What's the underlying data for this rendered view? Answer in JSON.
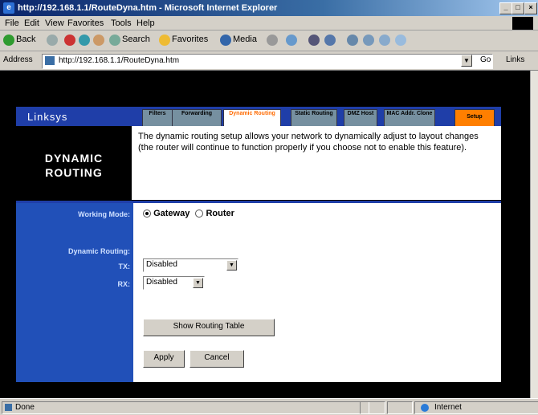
{
  "window": {
    "title": "http://192.168.1.1/RouteDyna.htm - Microsoft Internet Explorer",
    "min_btn": "_",
    "max_btn": "□",
    "close_btn": "×"
  },
  "menu": [
    "File",
    "Edit",
    "View",
    "Favorites",
    "Tools",
    "Help"
  ],
  "toolbar": {
    "back": "Back",
    "search": "Search",
    "favorites": "Favorites",
    "media": "Media"
  },
  "address": {
    "label": "Address",
    "url": "http://192.168.1.1/RouteDyna.htm",
    "go": "Go",
    "links": "Links"
  },
  "page": {
    "logo": "Linksys",
    "tabs": [
      {
        "label": "Filters"
      },
      {
        "label": "Forwarding"
      },
      {
        "label": "Dynamic Routing"
      },
      {
        "label": "Static Routing"
      },
      {
        "label": "DMZ Host"
      },
      {
        "label": "MAC Addr. Clone"
      },
      {
        "label": "Setup"
      }
    ],
    "section_title_line1": "DYNAMIC",
    "section_title_line2": "ROUTING",
    "description": "The dynamic routing setup allows your network to dynamically adjust to layout changes (the router will continue to function properly if you choose not to enable this feature).",
    "working_mode_label": "Working Mode:",
    "gateway_label": "Gateway",
    "router_label": "Router",
    "dynamic_routing_label": "Dynamic Routing:",
    "tx_label": "TX:",
    "rx_label": "RX:",
    "tx_value": "Disabled",
    "rx_value": "Disabled",
    "show_table_btn": "Show Routing Table",
    "apply_btn": "Apply",
    "cancel_btn": "Cancel"
  },
  "status": {
    "left": "Done",
    "zone": "Internet"
  },
  "colors": {
    "linksys_blue": "#1f3ea8",
    "tab_active_text": "#ff6a00",
    "setup_orange": "#ff7f00"
  }
}
